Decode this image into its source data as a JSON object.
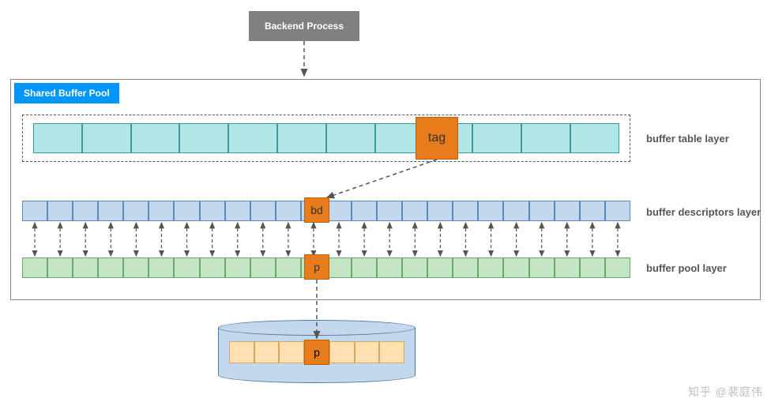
{
  "backend": {
    "label": "Backend Process"
  },
  "pool": {
    "label": "Shared Buffer Pool"
  },
  "tag": {
    "label": "tag"
  },
  "bd": {
    "label": "bd"
  },
  "p1": {
    "label": "p"
  },
  "p2": {
    "label": "p"
  },
  "layers": {
    "table": "buffer table layer",
    "desc": "buffer descriptors layer",
    "pool": "buffer pool layer"
  },
  "counts": {
    "table_cells": 12,
    "desc_cells": 24,
    "pool_cells": 24,
    "disk_cells": 7
  },
  "watermark": "知乎 @裴庭伟"
}
